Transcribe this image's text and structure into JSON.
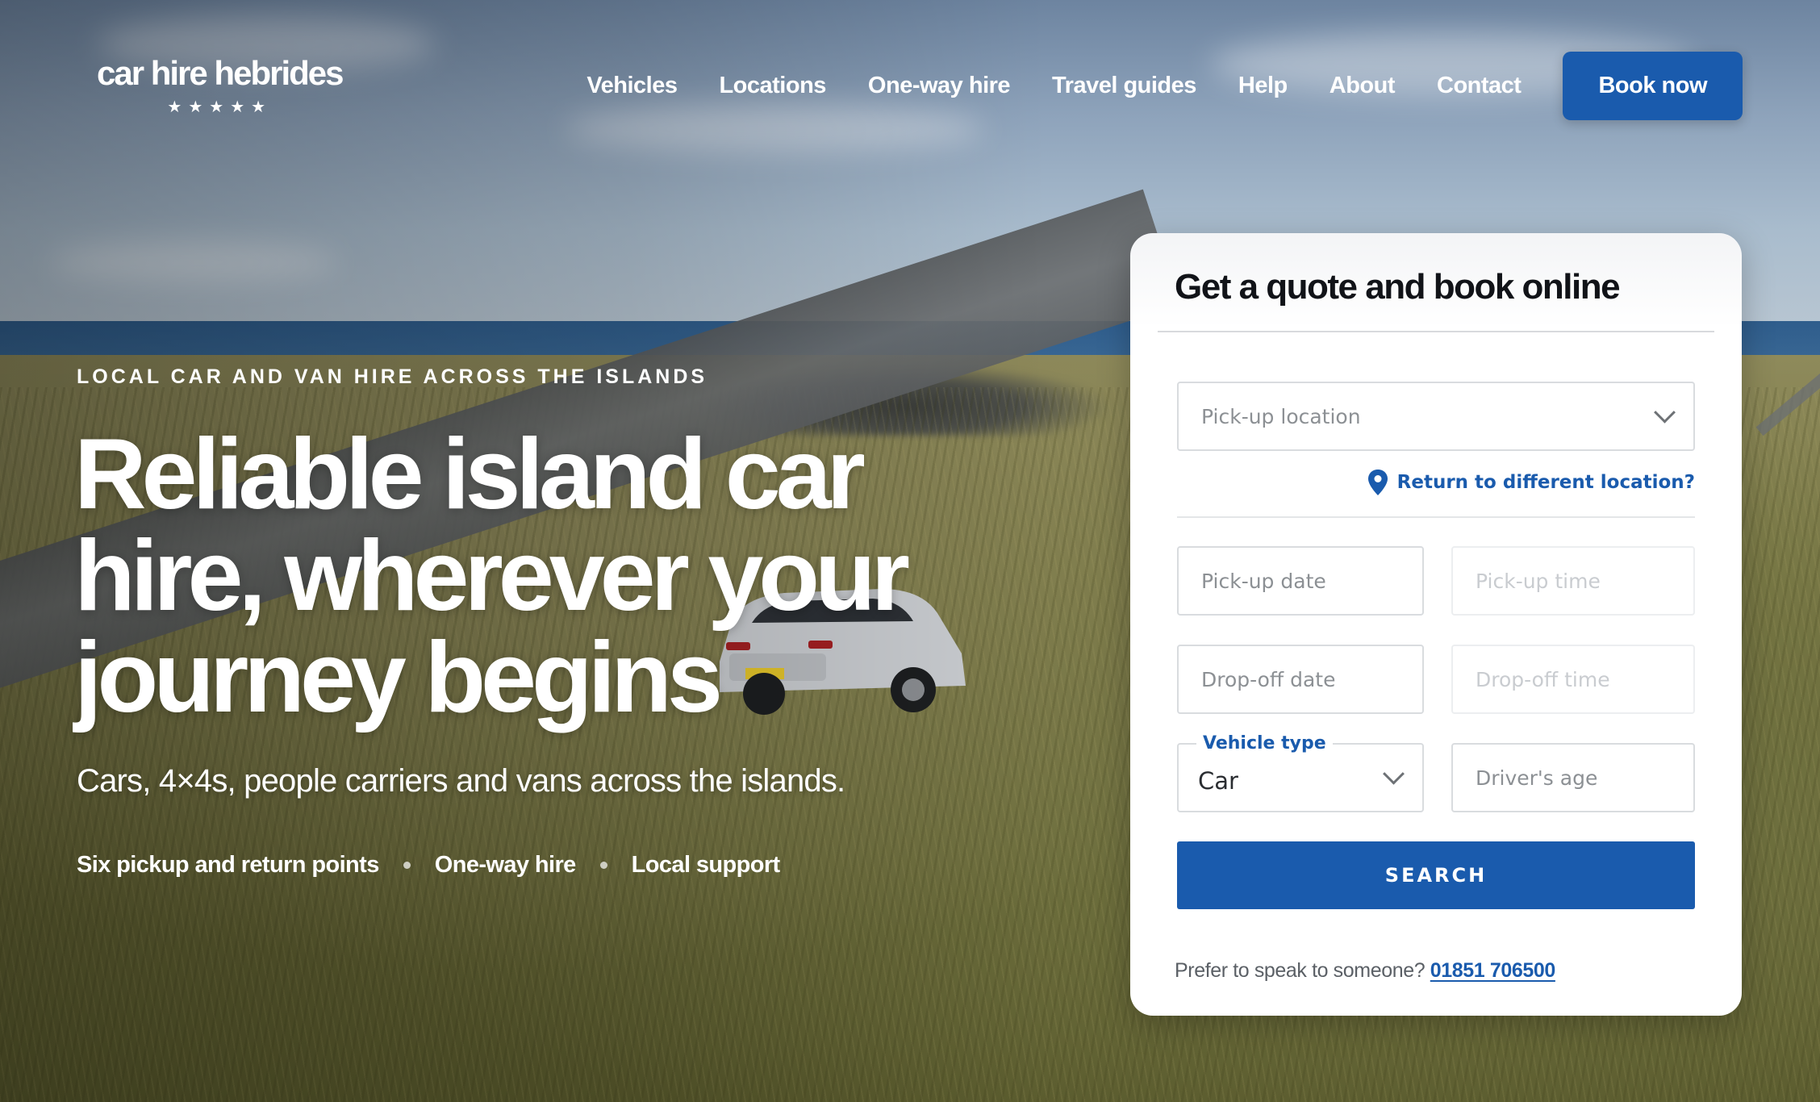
{
  "brand": {
    "name": "car hire hebrides",
    "stars": "★★★★★"
  },
  "nav": {
    "items": [
      {
        "label": "Vehicles"
      },
      {
        "label": "Locations"
      },
      {
        "label": "One-way hire"
      },
      {
        "label": "Travel guides"
      },
      {
        "label": "Help"
      },
      {
        "label": "About"
      },
      {
        "label": "Contact"
      }
    ],
    "cta_label": "Book now"
  },
  "hero": {
    "eyebrow": "LOCAL CAR AND VAN HIRE ACROSS THE ISLANDS",
    "headline_lines": [
      "Reliable island car",
      "hire, wherever your",
      "journey begins"
    ],
    "subline": "Cars, 4×4s, people carriers and vans across the islands.",
    "features": [
      "Six pickup and return points",
      "One-way hire",
      "Local support"
    ]
  },
  "quote_form": {
    "title": "Get a quote and book online",
    "pickup_location_placeholder": "Pick-up location",
    "return_link": "Return to different location?",
    "pickup_date_placeholder": "Pick-up date",
    "pickup_time_placeholder": "Pick-up time",
    "dropoff_date_placeholder": "Drop-off date",
    "dropoff_time_placeholder": "Drop-off time",
    "vehicle_type_label": "Vehicle type",
    "vehicle_type_value": "Car",
    "drivers_age_placeholder": "Driver's age",
    "search_label": "SEARCH",
    "phone_prompt": "Prefer to speak to someone?",
    "phone_number": "01851 706500"
  },
  "colors": {
    "accent": "#1a5bad",
    "card_background": "#ffffff",
    "text_dark": "#111318"
  },
  "icons": [
    "map-pin-icon",
    "chevron-down-icon"
  ]
}
